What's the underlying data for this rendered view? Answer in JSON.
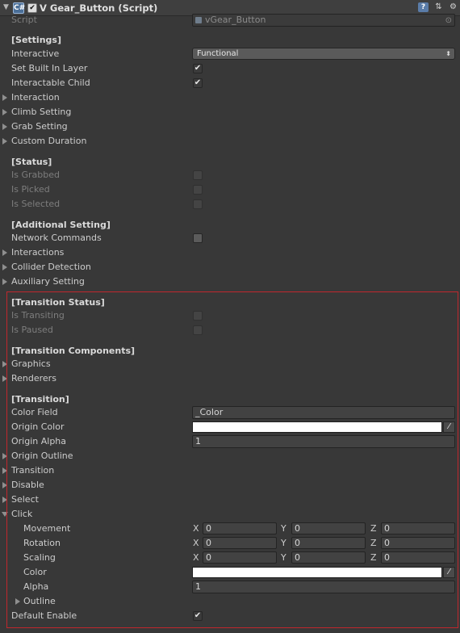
{
  "header": {
    "fold_glyph": "▼",
    "component_icon": "C#",
    "enabled_check": "✔",
    "title": "V Gear_Button (Script)",
    "help_icon": "?",
    "preset_icon": "⇅",
    "gear_icon": "⚙"
  },
  "script": {
    "label": "Script",
    "value": "vGear_Button",
    "picker": "⊙"
  },
  "settings": {
    "heading": "[Settings]",
    "interactive_label": "Interactive",
    "interactive_value": "Functional",
    "dropdown_arrow": "⬍",
    "set_built_in_layer": "Set Built In Layer",
    "interactable_child": "Interactable Child",
    "check": "✔",
    "interaction": "Interaction",
    "climb_setting": "Climb Setting",
    "grab_setting": "Grab Setting",
    "custom_duration": "Custom Duration"
  },
  "status": {
    "heading": "[Status]",
    "is_grabbed": "Is Grabbed",
    "is_picked": "Is Picked",
    "is_selected": "Is Selected"
  },
  "additional": {
    "heading": "[Additional Setting]",
    "network_commands": "Network Commands",
    "interactions": "Interactions",
    "collider_detection": "Collider Detection",
    "auxiliary_setting": "Auxiliary Setting"
  },
  "transition_status": {
    "heading": "[Transition Status]",
    "is_transiting": "Is Transiting",
    "is_paused": "Is Paused"
  },
  "transition_components": {
    "heading": "[Transition Components]",
    "graphics": "Graphics",
    "renderers": "Renderers"
  },
  "transition": {
    "heading": "[Transition]",
    "color_field_label": "Color Field",
    "color_field_value": "_Color",
    "origin_color": "Origin Color",
    "origin_alpha_label": "Origin Alpha",
    "origin_alpha_value": "1",
    "origin_outline": "Origin Outline",
    "transition": "Transition",
    "disable": "Disable",
    "select": "Select",
    "click": "Click",
    "picker_glyph": "⁄",
    "click_children": {
      "movement": {
        "label": "Movement",
        "x": "0",
        "y": "0",
        "z": "0"
      },
      "rotation": {
        "label": "Rotation",
        "x": "0",
        "y": "0",
        "z": "0"
      },
      "scaling": {
        "label": "Scaling",
        "x": "0",
        "y": "0",
        "z": "0"
      },
      "color_label": "Color",
      "alpha_label": "Alpha",
      "alpha_value": "1",
      "outline": "Outline"
    },
    "axis_x": "X",
    "axis_y": "Y",
    "axis_z": "Z"
  },
  "default_enable": "Default Enable",
  "colors": {
    "highlight_border": "#c0272d",
    "color_swatch": "#ffffff"
  }
}
